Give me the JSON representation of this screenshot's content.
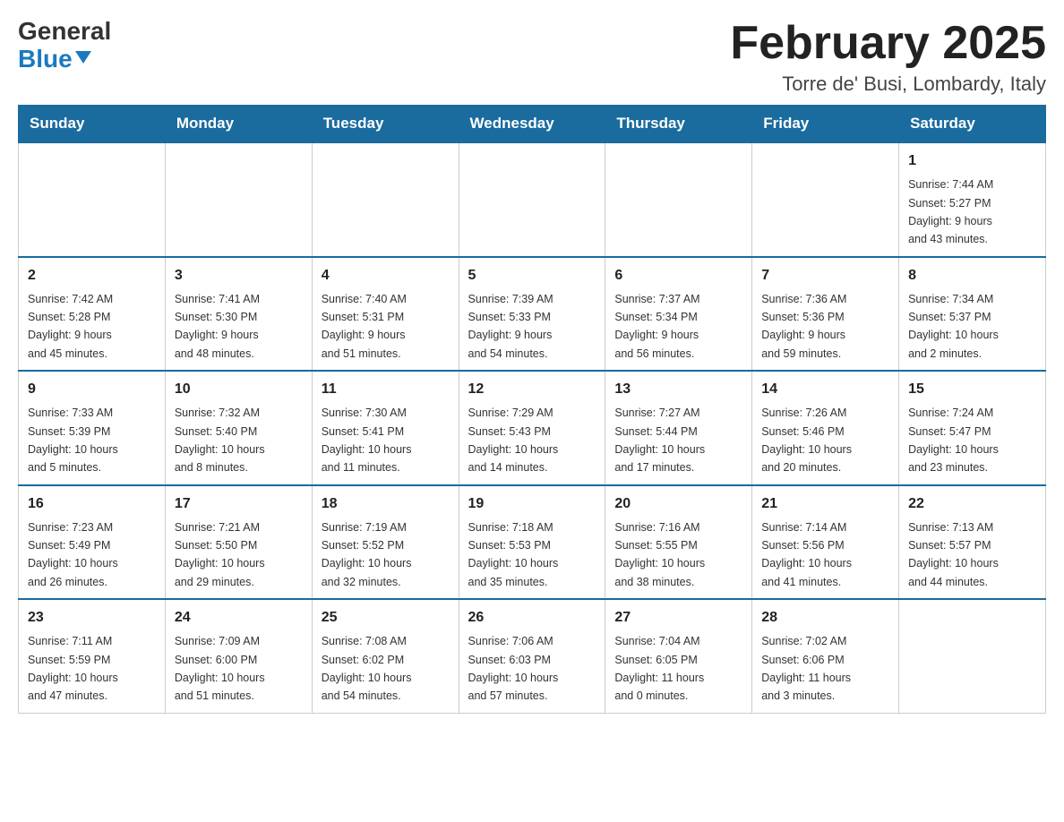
{
  "logo": {
    "general": "General",
    "blue": "Blue"
  },
  "header": {
    "title": "February 2025",
    "location": "Torre de' Busi, Lombardy, Italy"
  },
  "weekdays": [
    "Sunday",
    "Monday",
    "Tuesday",
    "Wednesday",
    "Thursday",
    "Friday",
    "Saturday"
  ],
  "weeks": [
    [
      {
        "day": "",
        "info": ""
      },
      {
        "day": "",
        "info": ""
      },
      {
        "day": "",
        "info": ""
      },
      {
        "day": "",
        "info": ""
      },
      {
        "day": "",
        "info": ""
      },
      {
        "day": "",
        "info": ""
      },
      {
        "day": "1",
        "info": "Sunrise: 7:44 AM\nSunset: 5:27 PM\nDaylight: 9 hours\nand 43 minutes."
      }
    ],
    [
      {
        "day": "2",
        "info": "Sunrise: 7:42 AM\nSunset: 5:28 PM\nDaylight: 9 hours\nand 45 minutes."
      },
      {
        "day": "3",
        "info": "Sunrise: 7:41 AM\nSunset: 5:30 PM\nDaylight: 9 hours\nand 48 minutes."
      },
      {
        "day": "4",
        "info": "Sunrise: 7:40 AM\nSunset: 5:31 PM\nDaylight: 9 hours\nand 51 minutes."
      },
      {
        "day": "5",
        "info": "Sunrise: 7:39 AM\nSunset: 5:33 PM\nDaylight: 9 hours\nand 54 minutes."
      },
      {
        "day": "6",
        "info": "Sunrise: 7:37 AM\nSunset: 5:34 PM\nDaylight: 9 hours\nand 56 minutes."
      },
      {
        "day": "7",
        "info": "Sunrise: 7:36 AM\nSunset: 5:36 PM\nDaylight: 9 hours\nand 59 minutes."
      },
      {
        "day": "8",
        "info": "Sunrise: 7:34 AM\nSunset: 5:37 PM\nDaylight: 10 hours\nand 2 minutes."
      }
    ],
    [
      {
        "day": "9",
        "info": "Sunrise: 7:33 AM\nSunset: 5:39 PM\nDaylight: 10 hours\nand 5 minutes."
      },
      {
        "day": "10",
        "info": "Sunrise: 7:32 AM\nSunset: 5:40 PM\nDaylight: 10 hours\nand 8 minutes."
      },
      {
        "day": "11",
        "info": "Sunrise: 7:30 AM\nSunset: 5:41 PM\nDaylight: 10 hours\nand 11 minutes."
      },
      {
        "day": "12",
        "info": "Sunrise: 7:29 AM\nSunset: 5:43 PM\nDaylight: 10 hours\nand 14 minutes."
      },
      {
        "day": "13",
        "info": "Sunrise: 7:27 AM\nSunset: 5:44 PM\nDaylight: 10 hours\nand 17 minutes."
      },
      {
        "day": "14",
        "info": "Sunrise: 7:26 AM\nSunset: 5:46 PM\nDaylight: 10 hours\nand 20 minutes."
      },
      {
        "day": "15",
        "info": "Sunrise: 7:24 AM\nSunset: 5:47 PM\nDaylight: 10 hours\nand 23 minutes."
      }
    ],
    [
      {
        "day": "16",
        "info": "Sunrise: 7:23 AM\nSunset: 5:49 PM\nDaylight: 10 hours\nand 26 minutes."
      },
      {
        "day": "17",
        "info": "Sunrise: 7:21 AM\nSunset: 5:50 PM\nDaylight: 10 hours\nand 29 minutes."
      },
      {
        "day": "18",
        "info": "Sunrise: 7:19 AM\nSunset: 5:52 PM\nDaylight: 10 hours\nand 32 minutes."
      },
      {
        "day": "19",
        "info": "Sunrise: 7:18 AM\nSunset: 5:53 PM\nDaylight: 10 hours\nand 35 minutes."
      },
      {
        "day": "20",
        "info": "Sunrise: 7:16 AM\nSunset: 5:55 PM\nDaylight: 10 hours\nand 38 minutes."
      },
      {
        "day": "21",
        "info": "Sunrise: 7:14 AM\nSunset: 5:56 PM\nDaylight: 10 hours\nand 41 minutes."
      },
      {
        "day": "22",
        "info": "Sunrise: 7:13 AM\nSunset: 5:57 PM\nDaylight: 10 hours\nand 44 minutes."
      }
    ],
    [
      {
        "day": "23",
        "info": "Sunrise: 7:11 AM\nSunset: 5:59 PM\nDaylight: 10 hours\nand 47 minutes."
      },
      {
        "day": "24",
        "info": "Sunrise: 7:09 AM\nSunset: 6:00 PM\nDaylight: 10 hours\nand 51 minutes."
      },
      {
        "day": "25",
        "info": "Sunrise: 7:08 AM\nSunset: 6:02 PM\nDaylight: 10 hours\nand 54 minutes."
      },
      {
        "day": "26",
        "info": "Sunrise: 7:06 AM\nSunset: 6:03 PM\nDaylight: 10 hours\nand 57 minutes."
      },
      {
        "day": "27",
        "info": "Sunrise: 7:04 AM\nSunset: 6:05 PM\nDaylight: 11 hours\nand 0 minutes."
      },
      {
        "day": "28",
        "info": "Sunrise: 7:02 AM\nSunset: 6:06 PM\nDaylight: 11 hours\nand 3 minutes."
      },
      {
        "day": "",
        "info": ""
      }
    ]
  ]
}
